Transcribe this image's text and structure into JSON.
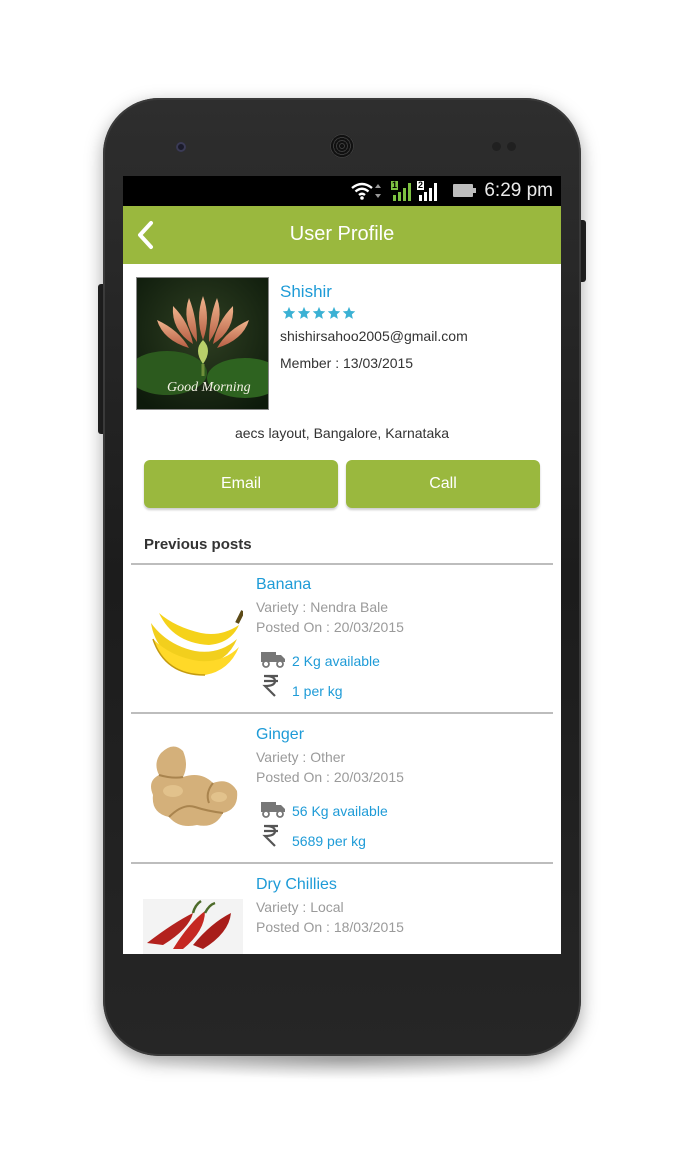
{
  "status_bar": {
    "time": "6:29 pm",
    "sim1": "1",
    "sim2": "2",
    "icons": [
      "wifi-icon",
      "signal-sim1-icon",
      "signal-sim2-icon",
      "battery-icon"
    ]
  },
  "app_bar": {
    "title": "User Profile",
    "back_icon": "chevron-left-icon"
  },
  "profile": {
    "name": "Shishir",
    "rating": 5,
    "rating_max": 5,
    "email": "shishirsahoo2005@gmail.com",
    "member": "Member : 13/03/2015",
    "address": "aecs layout, Bangalore, Karnataka",
    "avatar_caption": "Good Morning"
  },
  "actions": {
    "email_label": "Email",
    "call_label": "Call"
  },
  "posts_section": {
    "title": "Previous posts",
    "items": [
      {
        "title": "Banana",
        "variety": "Variety : Nendra Bale",
        "posted": "Posted On : 20/03/2015",
        "quantity": "2 Kg available",
        "price": "1 per kg",
        "image_icon": "banana-image"
      },
      {
        "title": "Ginger",
        "variety": "Variety : Other",
        "posted": "Posted On : 20/03/2015",
        "quantity": "56 Kg available",
        "price": "5689 per kg",
        "image_icon": "ginger-image"
      },
      {
        "title": "Dry Chillies",
        "variety": "Variety : Local",
        "posted": "Posted On : 18/03/2015",
        "quantity": "",
        "price": "",
        "image_icon": "chilli-image"
      }
    ]
  },
  "colors": {
    "accent": "#9ab83e",
    "link": "#1e9bd7",
    "star": "#3bb1d4"
  }
}
